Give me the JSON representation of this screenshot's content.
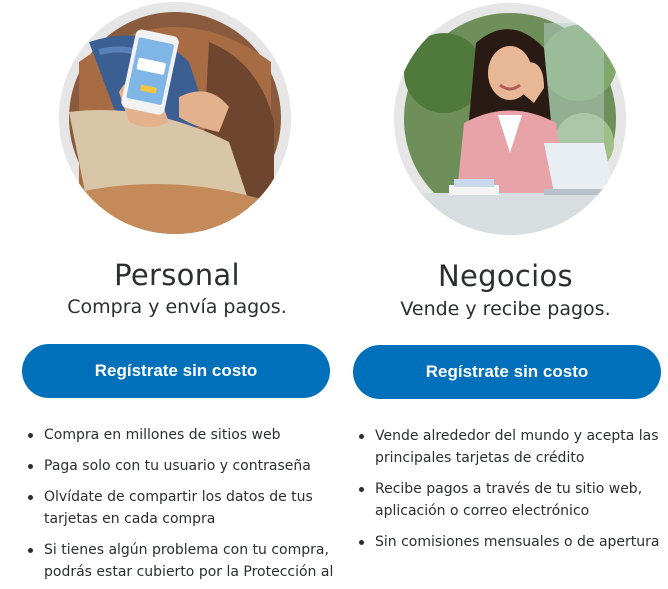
{
  "personal": {
    "title": "Personal",
    "subtitle": "Compra y envía pagos.",
    "cta_label": "Regístrate sin costo",
    "features": [
      "Compra en millones de sitios web",
      "Paga solo con tu usuario y contraseña",
      "Olvídate de compartir los datos de tus tarjetas en cada compra",
      "Si tienes algún problema con tu compra, podrás estar cubierto por la Protección al"
    ]
  },
  "business": {
    "title": "Negocios",
    "subtitle": "Vende y recibe pagos.",
    "cta_label": "Regístrate sin costo",
    "features": [
      "Vende alrededor del mundo y acepta las principales tarjetas de crédito",
      "Recibe pagos a través de tu sitio web, aplicación o correo electrónico",
      "Sin comisiones mensuales o de apertura"
    ]
  },
  "colors": {
    "button_blue": "#0070ba",
    "text_dark": "#2c2e2f",
    "ring_gray": "#e6e6e6"
  }
}
